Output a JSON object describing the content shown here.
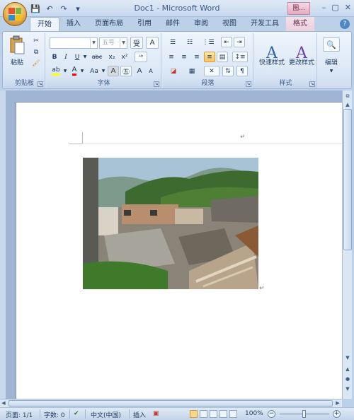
{
  "window": {
    "title": "Doc1 - Microsoft Word",
    "context_tag": "图...",
    "minimize": "–",
    "maximize": "▢",
    "close": "✕"
  },
  "qat": {
    "save": "💾",
    "undo": "↶",
    "redo": "↷",
    "customize": "▾"
  },
  "tabs": [
    "开始",
    "插入",
    "页面布局",
    "引用",
    "邮件",
    "审阅",
    "视图",
    "开发工具",
    "格式"
  ],
  "active_tab_index": 0,
  "ribbon": {
    "clipboard": {
      "label": "剪贴板",
      "paste": "粘贴"
    },
    "font": {
      "label": "字体",
      "font_name": "",
      "font_size": "五号",
      "bold": "B",
      "italic": "I",
      "underline": "U",
      "strike": "abc",
      "subscript": "x₂",
      "superscript": "x²",
      "change_case": "Aa",
      "grow": "A",
      "shrink": "A",
      "char_border": "A"
    },
    "paragraph": {
      "label": "段落"
    },
    "styles": {
      "label": "样式",
      "quick_styles": "快速样式",
      "change_styles": "更改样式"
    },
    "editing": {
      "label": "编辑"
    }
  },
  "document": {
    "paragraph_mark": "↵"
  },
  "status": {
    "page": "页面: 1/1",
    "words": "字数: 0",
    "language": "中文(中国)",
    "mode": "插入",
    "zoom": "100%",
    "zoom_minus": "−",
    "zoom_plus": "+"
  },
  "colors": {
    "highlight": "#ffff00",
    "font_color": "#ff0000",
    "accent": "#f7c25a"
  }
}
